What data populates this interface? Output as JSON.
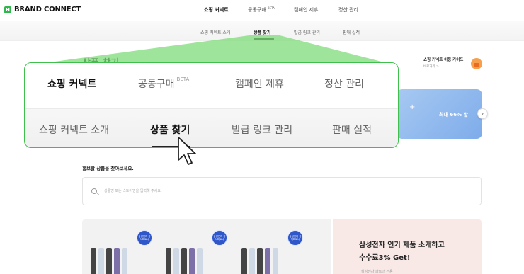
{
  "brand": {
    "mark": "H",
    "name": "BRAND CONNECT"
  },
  "main_nav": [
    {
      "label": "쇼핑 커넥트",
      "active": true,
      "badge": ""
    },
    {
      "label": "공동구매",
      "active": false,
      "badge": "BETA"
    },
    {
      "label": "캠페인 제휴",
      "active": false,
      "badge": ""
    },
    {
      "label": "정산 관리",
      "active": false,
      "badge": ""
    }
  ],
  "sub_nav": [
    {
      "label": "쇼핑 커넥트 소개",
      "active": false
    },
    {
      "label": "상품 찾기",
      "active": true
    },
    {
      "label": "발급 링크 관리",
      "active": false
    },
    {
      "label": "판매 실적",
      "active": false
    }
  ],
  "content": {
    "page_title_partial": "상품 찾기",
    "guide_title": "쇼핑 커넥트 이용 가이드",
    "guide_link": "바로가기 >",
    "banner_text": "최대 66% 할",
    "banner_next": "›",
    "prompt": "홍보할 상품을 찾아보세요.",
    "search_placeholder": "상품명 또는 스토어명을 입력해 주세요.",
    "product_badge": "삼성전자 공식파트너",
    "promo_line1": "삼성전자 인기 제품 소개하고",
    "promo_line2": "수수료3% Get!",
    "promo_sub": "삼성전자 파트너 전용"
  },
  "colors": {
    "brand_green": "#2db84b",
    "zoom_border": "#3fbf4b",
    "projection": "#7ddc7a",
    "promo_bg": "#f8e9e7"
  },
  "icons": {
    "search": "search-icon",
    "cursor": "mouse-pointer-icon",
    "next": "chevron-right-icon"
  }
}
